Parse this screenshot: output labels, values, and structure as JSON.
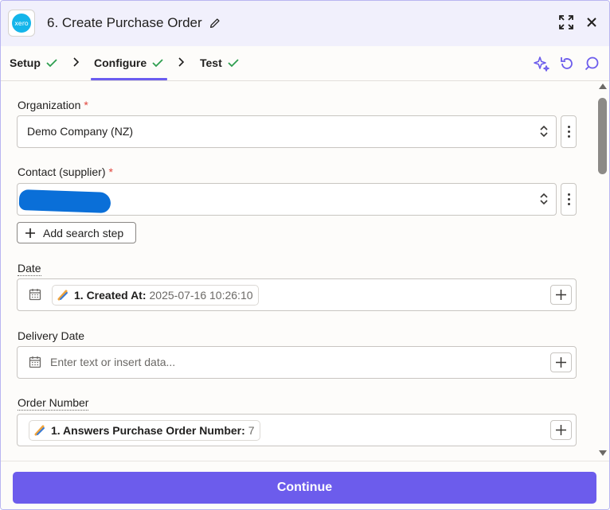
{
  "header": {
    "app_logo_text": "xero",
    "step_title": "6. Create Purchase Order"
  },
  "tabs": [
    {
      "label": "Setup",
      "done": true
    },
    {
      "label": "Configure",
      "done": true,
      "active": true
    },
    {
      "label": "Test",
      "done": true
    }
  ],
  "form": {
    "organization": {
      "label": "Organization",
      "required": "*",
      "value": "Demo Company (NZ)"
    },
    "contact": {
      "label": "Contact (supplier)",
      "required": "*",
      "value_redacted": true
    },
    "add_search_step": "Add search step",
    "date": {
      "label": "Date",
      "pill_key": "1. Created At:",
      "pill_value": "2025-07-16 10:26:10"
    },
    "delivery_date": {
      "label": "Delivery Date",
      "placeholder": "Enter text or insert data..."
    },
    "order_number": {
      "label": "Order Number",
      "pill_key": "1. Answers Purchase Order Number:",
      "pill_value": "7"
    }
  },
  "footer": {
    "continue_label": "Continue"
  },
  "colors": {
    "accent": "#6c5cec",
    "check": "#2e9e4f",
    "required": "#e0443b",
    "xero": "#13b5ea"
  }
}
